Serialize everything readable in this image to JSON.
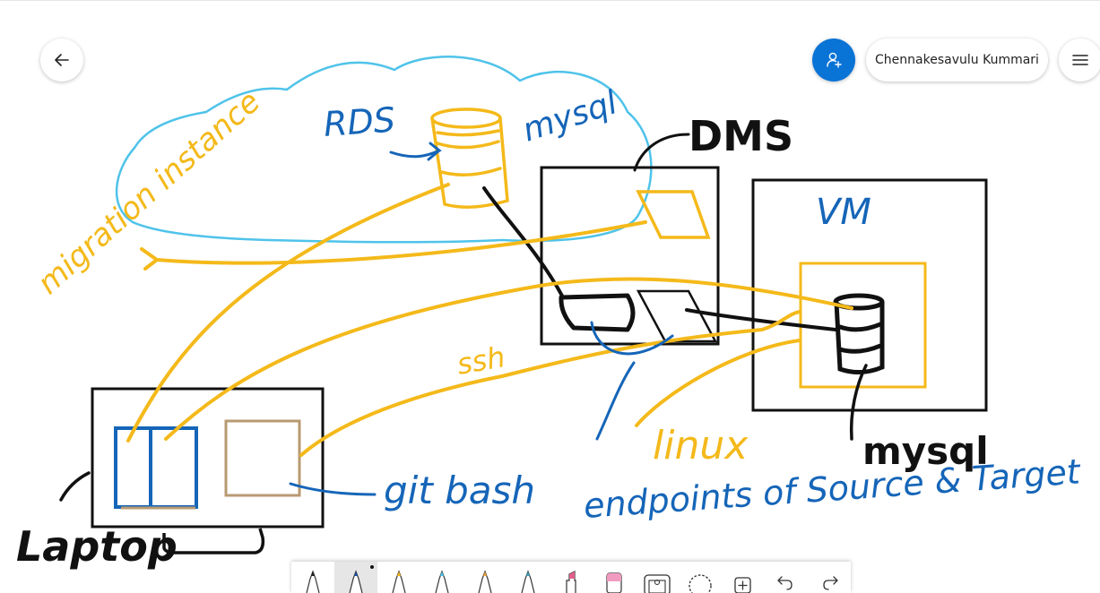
{
  "header": {
    "back_icon": "arrow-left-icon",
    "share_icon": "person-add-icon",
    "user_name": "Chennakesavulu Kummari",
    "menu_icon": "hamburger-icon"
  },
  "ink_labels": {
    "rds": "RDS",
    "mysql_cloud": "mysql",
    "dms": "DMS",
    "vm": "VM",
    "migration_instance": "migration instance",
    "ssh": "ssh",
    "linux": "linux",
    "mysql_vm": "mysql",
    "git_bash": "git bash",
    "endpoints": "endpoints of Source & Target",
    "laptop": "Laptop"
  },
  "colors": {
    "yellow_ink": "#f4b91a",
    "blue_ink": "#1565b8",
    "cloud_ink": "#4fc3ea",
    "black_ink": "#111111",
    "tan_ink": "#b89a72",
    "accent": "#0a73d6"
  },
  "toolbar": {
    "tools": [
      {
        "name": "black-pen-tool",
        "icon": "pen-icon",
        "color": "#222222"
      },
      {
        "name": "blue-pen-tool",
        "icon": "pen-icon",
        "color": "#1d4f9c",
        "selected": true
      },
      {
        "name": "yellow-pen-tool",
        "icon": "pen-icon",
        "color": "#f4b91a"
      },
      {
        "name": "cyan-pen-tool",
        "icon": "pen-icon",
        "color": "#4fc3ea"
      },
      {
        "name": "orange-pen-tool",
        "icon": "pen-icon",
        "color": "#e8a33a"
      },
      {
        "name": "teal-pen-tool",
        "icon": "pen-icon",
        "color": "#3aa3b8"
      },
      {
        "name": "highlighter-tool",
        "icon": "highlighter-icon",
        "color": "#e0608a"
      },
      {
        "name": "eraser-tool",
        "icon": "eraser-icon",
        "color": "#f29bc0"
      },
      {
        "name": "image-tool",
        "icon": "image-icon"
      },
      {
        "name": "lasso-tool",
        "icon": "lasso-icon"
      },
      {
        "name": "add-tool",
        "icon": "add-box-icon"
      },
      {
        "name": "undo-tool",
        "icon": "undo-icon"
      },
      {
        "name": "redo-tool",
        "icon": "redo-icon"
      }
    ]
  }
}
